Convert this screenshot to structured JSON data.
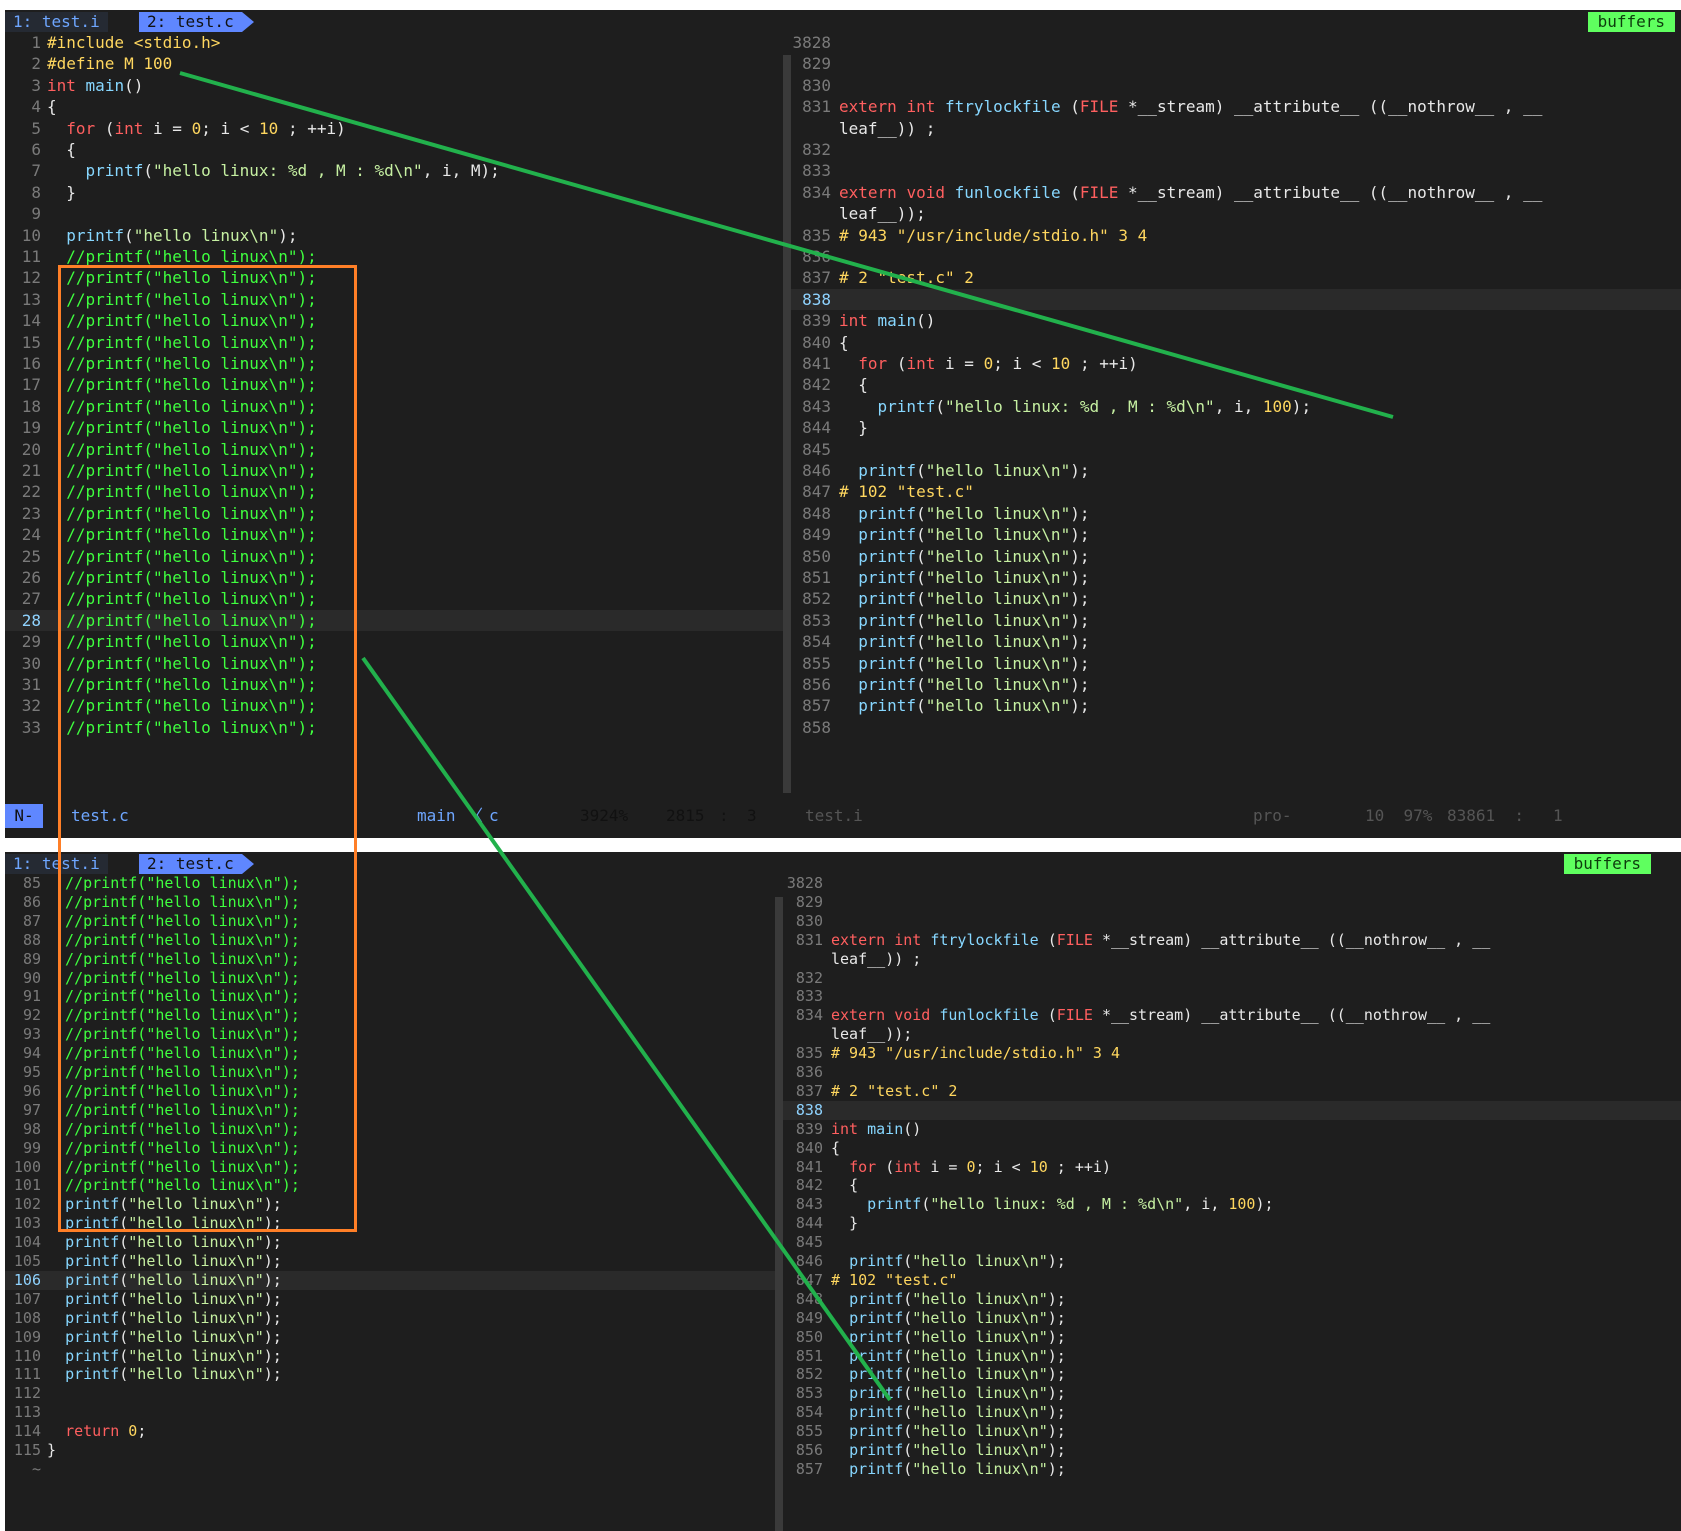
{
  "top": {
    "tabs": [
      {
        "label": "1: test.i"
      },
      {
        "label": "2: test.c"
      }
    ],
    "buffers_label": "buffers",
    "left_lines": [
      {
        "n": "1",
        "text": "#include <stdio.h>"
      },
      {
        "n": "2",
        "text": "#define M 100"
      },
      {
        "n": "3",
        "text": "int main()"
      },
      {
        "n": "4",
        "text": "{"
      },
      {
        "n": "5",
        "text": "  for (int i = 0; i < 10 ; ++i)"
      },
      {
        "n": "6",
        "text": "  {"
      },
      {
        "n": "7",
        "text": "    printf(\"hello linux: %d , M : %d\\n\", i, M);"
      },
      {
        "n": "8",
        "text": "  }"
      },
      {
        "n": "9",
        "text": ""
      },
      {
        "n": "10",
        "text": "  printf(\"hello linux\\n\");"
      },
      {
        "n": "11",
        "text": "  //printf(\"hello linux\\n\");"
      },
      {
        "n": "12",
        "text": "  //printf(\"hello linux\\n\");"
      },
      {
        "n": "13",
        "text": "  //printf(\"hello linux\\n\");"
      },
      {
        "n": "14",
        "text": "  //printf(\"hello linux\\n\");"
      },
      {
        "n": "15",
        "text": "  //printf(\"hello linux\\n\");"
      },
      {
        "n": "16",
        "text": "  //printf(\"hello linux\\n\");"
      },
      {
        "n": "17",
        "text": "  //printf(\"hello linux\\n\");"
      },
      {
        "n": "18",
        "text": "  //printf(\"hello linux\\n\");"
      },
      {
        "n": "19",
        "text": "  //printf(\"hello linux\\n\");"
      },
      {
        "n": "20",
        "text": "  //printf(\"hello linux\\n\");"
      },
      {
        "n": "21",
        "text": "  //printf(\"hello linux\\n\");"
      },
      {
        "n": "22",
        "text": "  //printf(\"hello linux\\n\");"
      },
      {
        "n": "23",
        "text": "  //printf(\"hello linux\\n\");"
      },
      {
        "n": "24",
        "text": "  //printf(\"hello linux\\n\");"
      },
      {
        "n": "25",
        "text": "  //printf(\"hello linux\\n\");"
      },
      {
        "n": "26",
        "text": "  //printf(\"hello linux\\n\");"
      },
      {
        "n": "27",
        "text": "  //printf(\"hello linux\\n\");"
      },
      {
        "n": "28",
        "text": "  //printf(\"hello linux\\n\");",
        "current": true
      },
      {
        "n": "29",
        "text": "  //printf(\"hello linux\\n\");"
      },
      {
        "n": "30",
        "text": "  //printf(\"hello linux\\n\");"
      },
      {
        "n": "31",
        "text": "  //printf(\"hello linux\\n\");"
      },
      {
        "n": "32",
        "text": "  //printf(\"hello linux\\n\");"
      },
      {
        "n": "33",
        "text": "  //printf(\"hello linux\\n\");"
      }
    ],
    "right_lines": [
      {
        "n": "3828",
        "text": ""
      },
      {
        "n": "829",
        "text": ""
      },
      {
        "n": "830",
        "text": ""
      },
      {
        "n": "831",
        "text": "extern int ftrylockfile (FILE *__stream) __attribute__ ((__nothrow__ , __"
      },
      {
        "n": "",
        "text": "leaf__)) ;"
      },
      {
        "n": "832",
        "text": ""
      },
      {
        "n": "833",
        "text": ""
      },
      {
        "n": "834",
        "text": "extern void funlockfile (FILE *__stream) __attribute__ ((__nothrow__ , __"
      },
      {
        "n": "",
        "text": "leaf__));"
      },
      {
        "n": "835",
        "text": "# 943 \"/usr/include/stdio.h\" 3 4"
      },
      {
        "n": "836",
        "text": ""
      },
      {
        "n": "837",
        "text": "# 2 \"test.c\" 2"
      },
      {
        "n": "838",
        "text": "",
        "current": true
      },
      {
        "n": "839",
        "text": "int main()"
      },
      {
        "n": "840",
        "text": "{"
      },
      {
        "n": "841",
        "text": "  for (int i = 0; i < 10 ; ++i)"
      },
      {
        "n": "842",
        "text": "  {"
      },
      {
        "n": "843",
        "text": "    printf(\"hello linux: %d , M : %d\\n\", i, 100);"
      },
      {
        "n": "844",
        "text": "  }"
      },
      {
        "n": "845",
        "text": ""
      },
      {
        "n": "846",
        "text": "  printf(\"hello linux\\n\");"
      },
      {
        "n": "847",
        "text": "# 102 \"test.c\""
      },
      {
        "n": "848",
        "text": "  printf(\"hello linux\\n\");"
      },
      {
        "n": "849",
        "text": "  printf(\"hello linux\\n\");"
      },
      {
        "n": "850",
        "text": "  printf(\"hello linux\\n\");"
      },
      {
        "n": "851",
        "text": "  printf(\"hello linux\\n\");"
      },
      {
        "n": "852",
        "text": "  printf(\"hello linux\\n\");"
      },
      {
        "n": "853",
        "text": "  printf(\"hello linux\\n\");"
      },
      {
        "n": "854",
        "text": "  printf(\"hello linux\\n\");"
      },
      {
        "n": "855",
        "text": "  printf(\"hello linux\\n\");"
      },
      {
        "n": "856",
        "text": "  printf(\"hello linux\\n\");"
      },
      {
        "n": "857",
        "text": "  printf(\"hello linux\\n\");"
      },
      {
        "n": "858",
        "text": ""
      }
    ],
    "status": {
      "mode": "N-",
      "filename": "test.c",
      "func": "main",
      "sep": "〈",
      "filetype": "c",
      "percent": "3924%",
      "line": "2815",
      "colon": ":",
      "col": "3",
      "right_filename": "test.i",
      "right_ft": "pro-",
      "right_pos": "10  97%",
      "right_lc": "83861  :   1"
    }
  },
  "bottom": {
    "tabs": [
      {
        "label": "1: test.i"
      },
      {
        "label": "2: test.c"
      }
    ],
    "buffers_label": "buffers",
    "left_lines": [
      {
        "n": "85",
        "text": "  //printf(\"hello linux\\n\");"
      },
      {
        "n": "86",
        "text": "  //printf(\"hello linux\\n\");"
      },
      {
        "n": "87",
        "text": "  //printf(\"hello linux\\n\");"
      },
      {
        "n": "88",
        "text": "  //printf(\"hello linux\\n\");"
      },
      {
        "n": "89",
        "text": "  //printf(\"hello linux\\n\");"
      },
      {
        "n": "90",
        "text": "  //printf(\"hello linux\\n\");"
      },
      {
        "n": "91",
        "text": "  //printf(\"hello linux\\n\");"
      },
      {
        "n": "92",
        "text": "  //printf(\"hello linux\\n\");"
      },
      {
        "n": "93",
        "text": "  //printf(\"hello linux\\n\");"
      },
      {
        "n": "94",
        "text": "  //printf(\"hello linux\\n\");"
      },
      {
        "n": "95",
        "text": "  //printf(\"hello linux\\n\");"
      },
      {
        "n": "96",
        "text": "  //printf(\"hello linux\\n\");"
      },
      {
        "n": "97",
        "text": "  //printf(\"hello linux\\n\");"
      },
      {
        "n": "98",
        "text": "  //printf(\"hello linux\\n\");"
      },
      {
        "n": "99",
        "text": "  //printf(\"hello linux\\n\");"
      },
      {
        "n": "100",
        "text": "  //printf(\"hello linux\\n\");"
      },
      {
        "n": "101",
        "text": "  //printf(\"hello linux\\n\");"
      },
      {
        "n": "102",
        "text": "  printf(\"hello linux\\n\");"
      },
      {
        "n": "103",
        "text": "  printf(\"hello linux\\n\");"
      },
      {
        "n": "104",
        "text": "  printf(\"hello linux\\n\");"
      },
      {
        "n": "105",
        "text": "  printf(\"hello linux\\n\");"
      },
      {
        "n": "106",
        "text": "  printf(\"hello linux\\n\");",
        "current": true
      },
      {
        "n": "107",
        "text": "  printf(\"hello linux\\n\");"
      },
      {
        "n": "108",
        "text": "  printf(\"hello linux\\n\");"
      },
      {
        "n": "109",
        "text": "  printf(\"hello linux\\n\");"
      },
      {
        "n": "110",
        "text": "  printf(\"hello linux\\n\");"
      },
      {
        "n": "111",
        "text": "  printf(\"hello linux\\n\");"
      },
      {
        "n": "112",
        "text": ""
      },
      {
        "n": "113",
        "text": ""
      },
      {
        "n": "114",
        "text": "  return 0;"
      },
      {
        "n": "115",
        "text": "}"
      },
      {
        "n": "~",
        "text": ""
      }
    ],
    "right_lines": [
      {
        "n": "3828",
        "text": ""
      },
      {
        "n": "829",
        "text": ""
      },
      {
        "n": "830",
        "text": ""
      },
      {
        "n": "831",
        "text": "extern int ftrylockfile (FILE *__stream) __attribute__ ((__nothrow__ , __"
      },
      {
        "n": "",
        "text": "leaf__)) ;"
      },
      {
        "n": "832",
        "text": ""
      },
      {
        "n": "833",
        "text": ""
      },
      {
        "n": "834",
        "text": "extern void funlockfile (FILE *__stream) __attribute__ ((__nothrow__ , __"
      },
      {
        "n": "",
        "text": "leaf__));"
      },
      {
        "n": "835",
        "text": "# 943 \"/usr/include/stdio.h\" 3 4"
      },
      {
        "n": "836",
        "text": ""
      },
      {
        "n": "837",
        "text": "# 2 \"test.c\" 2"
      },
      {
        "n": "838",
        "text": "",
        "current": true
      },
      {
        "n": "839",
        "text": "int main()"
      },
      {
        "n": "840",
        "text": "{"
      },
      {
        "n": "841",
        "text": "  for (int i = 0; i < 10 ; ++i)"
      },
      {
        "n": "842",
        "text": "  {"
      },
      {
        "n": "843",
        "text": "    printf(\"hello linux: %d , M : %d\\n\", i, 100);"
      },
      {
        "n": "844",
        "text": "  }"
      },
      {
        "n": "845",
        "text": ""
      },
      {
        "n": "846",
        "text": "  printf(\"hello linux\\n\");"
      },
      {
        "n": "847",
        "text": "# 102 \"test.c\""
      },
      {
        "n": "848",
        "text": "  printf(\"hello linux\\n\");"
      },
      {
        "n": "849",
        "text": "  printf(\"hello linux\\n\");"
      },
      {
        "n": "850",
        "text": "  printf(\"hello linux\\n\");"
      },
      {
        "n": "851",
        "text": "  printf(\"hello linux\\n\");"
      },
      {
        "n": "852",
        "text": "  printf(\"hello linux\\n\");"
      },
      {
        "n": "853",
        "text": "  printf(\"hello linux\\n\");"
      },
      {
        "n": "854",
        "text": "  printf(\"hello linux\\n\");"
      },
      {
        "n": "855",
        "text": "  printf(\"hello linux\\n\");"
      },
      {
        "n": "856",
        "text": "  printf(\"hello linux\\n\");"
      },
      {
        "n": "857",
        "text": "  printf(\"hello linux\\n\");"
      }
    ]
  },
  "colors": {
    "arrow": "#22b14c",
    "highlight_box": "#ff7f27",
    "tab_active": "#5f87ff",
    "buffers": "#5fff5f",
    "comment": "#3fff3f"
  }
}
